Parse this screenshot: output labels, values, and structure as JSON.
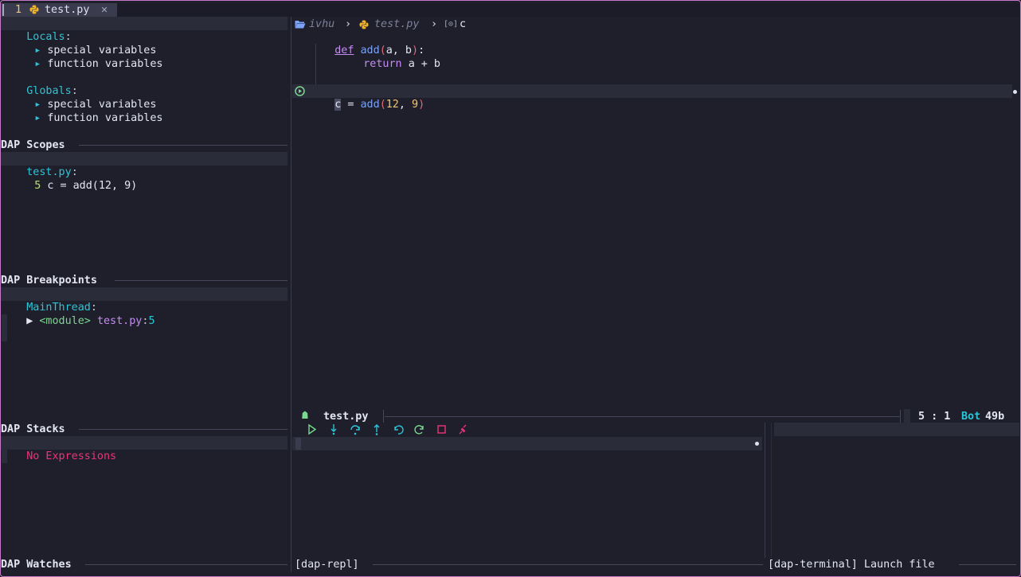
{
  "tabline": {
    "tab_number": "1",
    "tab_name": "test.py",
    "close": "✕"
  },
  "variables": {
    "locals_label": "Locals",
    "globals_label": "Globals",
    "items": [
      "special variables",
      "function variables"
    ]
  },
  "scopes": {
    "title": "DAP Scopes",
    "file": "test.py",
    "line_number": "5",
    "line_code": "c = add(12, 9)"
  },
  "breakpoints": {
    "title": "DAP Breakpoints",
    "thread": "MainThread",
    "frame_module": "<module>",
    "frame_file": "test.py",
    "frame_line": "5"
  },
  "stacks": {
    "title": "DAP Stacks",
    "empty_text": "No Expressions"
  },
  "watches": {
    "title": "DAP Watches"
  },
  "breadcrumb": {
    "folder": "ivhu",
    "file": "test.py",
    "symbol": "c",
    "separator": "›"
  },
  "code": {
    "def_kw": "def",
    "fn_name": "add",
    "params": "a, b",
    "return_kw": "return",
    "return_expr": "a + b",
    "assign_var": "c",
    "assign_eq": "=",
    "call_fn": "add",
    "arg1": "12",
    "arg2": "9"
  },
  "statusline": {
    "filename": "test.py",
    "position": "5 : 1",
    "scroll": "Bot",
    "size": "49b"
  },
  "repl": {
    "title": "[dap-repl]"
  },
  "terminal": {
    "title": "[dap-terminal] Launch file"
  },
  "colors": {
    "accent_cyan": "#2bc6d8",
    "accent_green": "#7bd88f",
    "accent_purple": "#c58cf2",
    "accent_pink": "#f0327a",
    "background": "#1e1f2b"
  },
  "toolbar_icons": [
    "play-icon",
    "step-into-icon",
    "step-over-icon",
    "step-out-icon",
    "step-back-icon",
    "restart-icon",
    "stop-icon",
    "disconnect-icon"
  ]
}
